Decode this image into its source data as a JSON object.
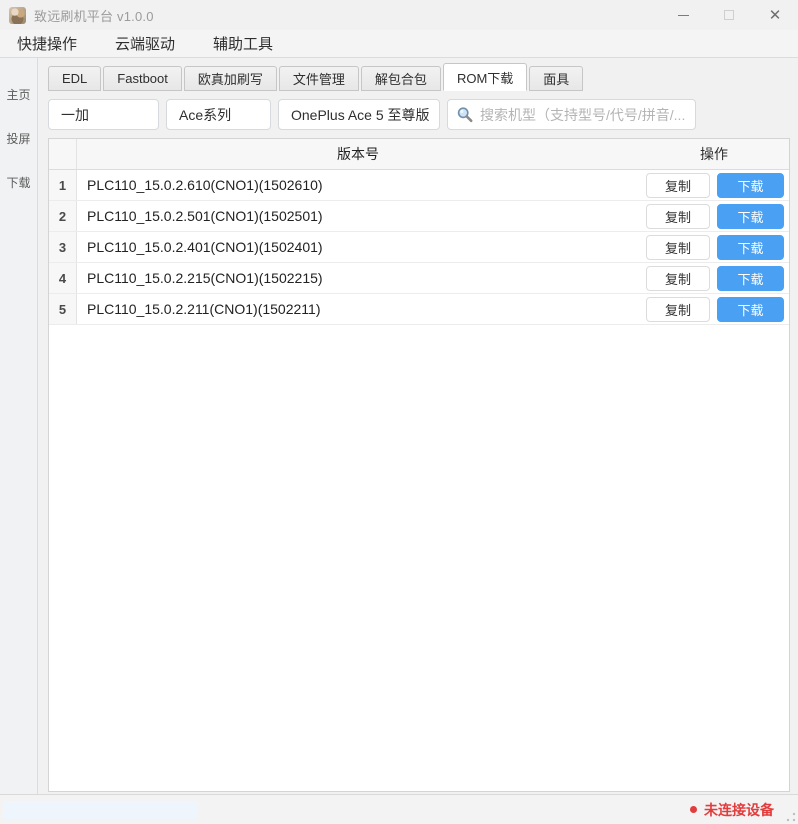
{
  "window": {
    "title": "致远刷机平台 v1.0.0"
  },
  "titlebar": {
    "minimize_icon": "minimize",
    "maximize_icon": "maximize",
    "close_glyph": "✕"
  },
  "menu": {
    "items": [
      "快捷操作",
      "云端驱动",
      "辅助工具"
    ]
  },
  "sidebar": {
    "items": [
      "主页",
      "投屏",
      "下载"
    ]
  },
  "tabs": {
    "active_index": 5,
    "items": [
      "EDL",
      "Fastboot",
      "欧真加刷写",
      "文件管理",
      "解包合包",
      "ROM下载",
      "面具"
    ]
  },
  "filters": {
    "brand": "一加",
    "series": "Ace系列",
    "model": "OnePlus Ace 5 至尊版",
    "search_placeholder": "搜索机型（支持型号/代号/拼音/..."
  },
  "table": {
    "headers": {
      "index": "",
      "version": "版本号",
      "action": "操作"
    },
    "actions": {
      "copy": "复制",
      "download": "下载"
    },
    "rows": [
      {
        "index": "1",
        "version": "PLC110_15.0.2.610(CNO1)(1502610)"
      },
      {
        "index": "2",
        "version": "PLC110_15.0.2.501(CNO1)(1502501)"
      },
      {
        "index": "3",
        "version": "PLC110_15.0.2.401(CNO1)(1502401)"
      },
      {
        "index": "4",
        "version": "PLC110_15.0.2.215(CNO1)(1502215)"
      },
      {
        "index": "5",
        "version": "PLC110_15.0.2.211(CNO1)(1502211)"
      }
    ]
  },
  "status": {
    "device": "未连接设备"
  },
  "colors": {
    "accent_blue": "#4aa0f2",
    "status_red": "#e23c3c"
  }
}
